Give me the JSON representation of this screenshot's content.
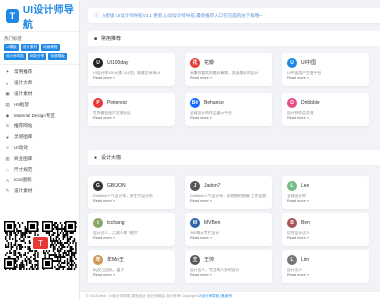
{
  "brand": {
    "mark": "T",
    "name": "UI设计师导航"
  },
  "hot": {
    "title": "热门标签",
    "tags": [
      "UI模板",
      "设计素材",
      "动画教程",
      "设计师导航",
      "网站分享",
      "免费模板"
    ]
  },
  "nav": [
    {
      "icon": "flame-icon",
      "glyph": "✦",
      "label": "常用推荐"
    },
    {
      "icon": "palette-icon",
      "glyph": "◐",
      "label": "设计大师"
    },
    {
      "icon": "image-icon",
      "glyph": "▣",
      "label": "设计素材"
    },
    {
      "icon": "h5-icon",
      "glyph": "▤",
      "label": "H5框架"
    },
    {
      "icon": "diamond-icon",
      "glyph": "◆",
      "label": "Material Design专区"
    },
    {
      "icon": "crown-icon",
      "glyph": "♔",
      "label": "推荐网站"
    },
    {
      "icon": "heart-icon",
      "glyph": "♥",
      "label": "灵感图库"
    },
    {
      "icon": "layers-icon",
      "glyph": "≡",
      "label": "UI动效"
    },
    {
      "icon": "bag-icon",
      "glyph": "▥",
      "label": "商业图库"
    },
    {
      "icon": "ruler-icon",
      "glyph": "⌂",
      "label": "尺寸规范"
    },
    {
      "icon": "font-icon",
      "glyph": "A",
      "label": "icon图标"
    },
    {
      "icon": "brush-icon",
      "glyph": "✎",
      "label": "设计素材"
    }
  ],
  "notice": {
    "text": "5星级 UI设计师导航V3.1 更新,心动设计师导航,最新推荐入口在页面的左下角哦~"
  },
  "sections": {
    "common": {
      "title": "常用推荐"
    },
    "masters": {
      "title": "设计大咖"
    }
  },
  "common_cards": [
    {
      "name": "UI100day",
      "color": "#222",
      "glyph": "U",
      "desc": "UI设计师100天练习计划，助推您享有UI",
      "more": "Read more »"
    },
    {
      "name": "花瓣",
      "color": "#e53935",
      "glyph": "花",
      "desc": "采集你喜欢的美好事物，发现美好的设计",
      "more": "Read more »"
    },
    {
      "name": "UI中国",
      "color": "#1e88e5",
      "glyph": "U",
      "desc": "UI中国用户交流平台",
      "more": "Read more »"
    },
    {
      "name": "Pinterest",
      "color": "#e53935",
      "glyph": "P",
      "desc": "世界最佳图片交流社区",
      "more": "Read more »"
    },
    {
      "name": "Behance",
      "color": "#1769ff",
      "glyph": "Bē",
      "desc": "全球设计师作品展示平台",
      "more": "Read more »"
    },
    {
      "name": "Dribbble",
      "color": "#ea4c89",
      "glyph": "D",
      "desc": "设计师作品交流",
      "more": "Read more »"
    }
  ],
  "master_cards": [
    {
      "name": "GBIJON",
      "color": "#333",
      "glyph": "G",
      "desc": "Dribbble人气设计师，原生代设计师",
      "more": "Read more »"
    },
    {
      "name": "Jadon7",
      "color": "#555",
      "glyph": "J",
      "desc": "Dribbble人气设计师，用理想的眼睛 工作室第三工作室",
      "more": "Read more »"
    },
    {
      "name": "Lee",
      "color": "#7b8",
      "glyph": "L",
      "desc": "全球设计师",
      "more": "Read more »"
    },
    {
      "name": "tcchang",
      "color": "#8a6",
      "glyph": "t",
      "desc": "设计达人，江湖人称 \"晓尔\"",
      "more": "Read more »"
    },
    {
      "name": "MVBen",
      "color": "#36a",
      "glyph": "M",
      "desc": "365每天专栏设计",
      "more": "Read more »"
    },
    {
      "name": "Ben",
      "color": "#a55",
      "glyph": "B",
      "desc": "优秀设计达人",
      "more": "Read more »"
    },
    {
      "name": "年Mo王",
      "color": "#c95",
      "glyph": "年",
      "desc": "Bg交互团队，嘉子",
      "more": "Read more »"
    },
    {
      "name": "王帅",
      "color": "#555",
      "glyph": "王",
      "desc": "设计达人，专注的人多的设计",
      "more": "Read more »"
    },
    {
      "name": "Lim",
      "color": "#777",
      "glyph": "L",
      "desc": "设计达人",
      "more": "Read more »"
    }
  ],
  "footer": {
    "text": "© 2018 Web · UI设计师导航 原型设计 设计师网站 设计参考 Copyright",
    "link": "UI设计师导航 |备案号"
  }
}
